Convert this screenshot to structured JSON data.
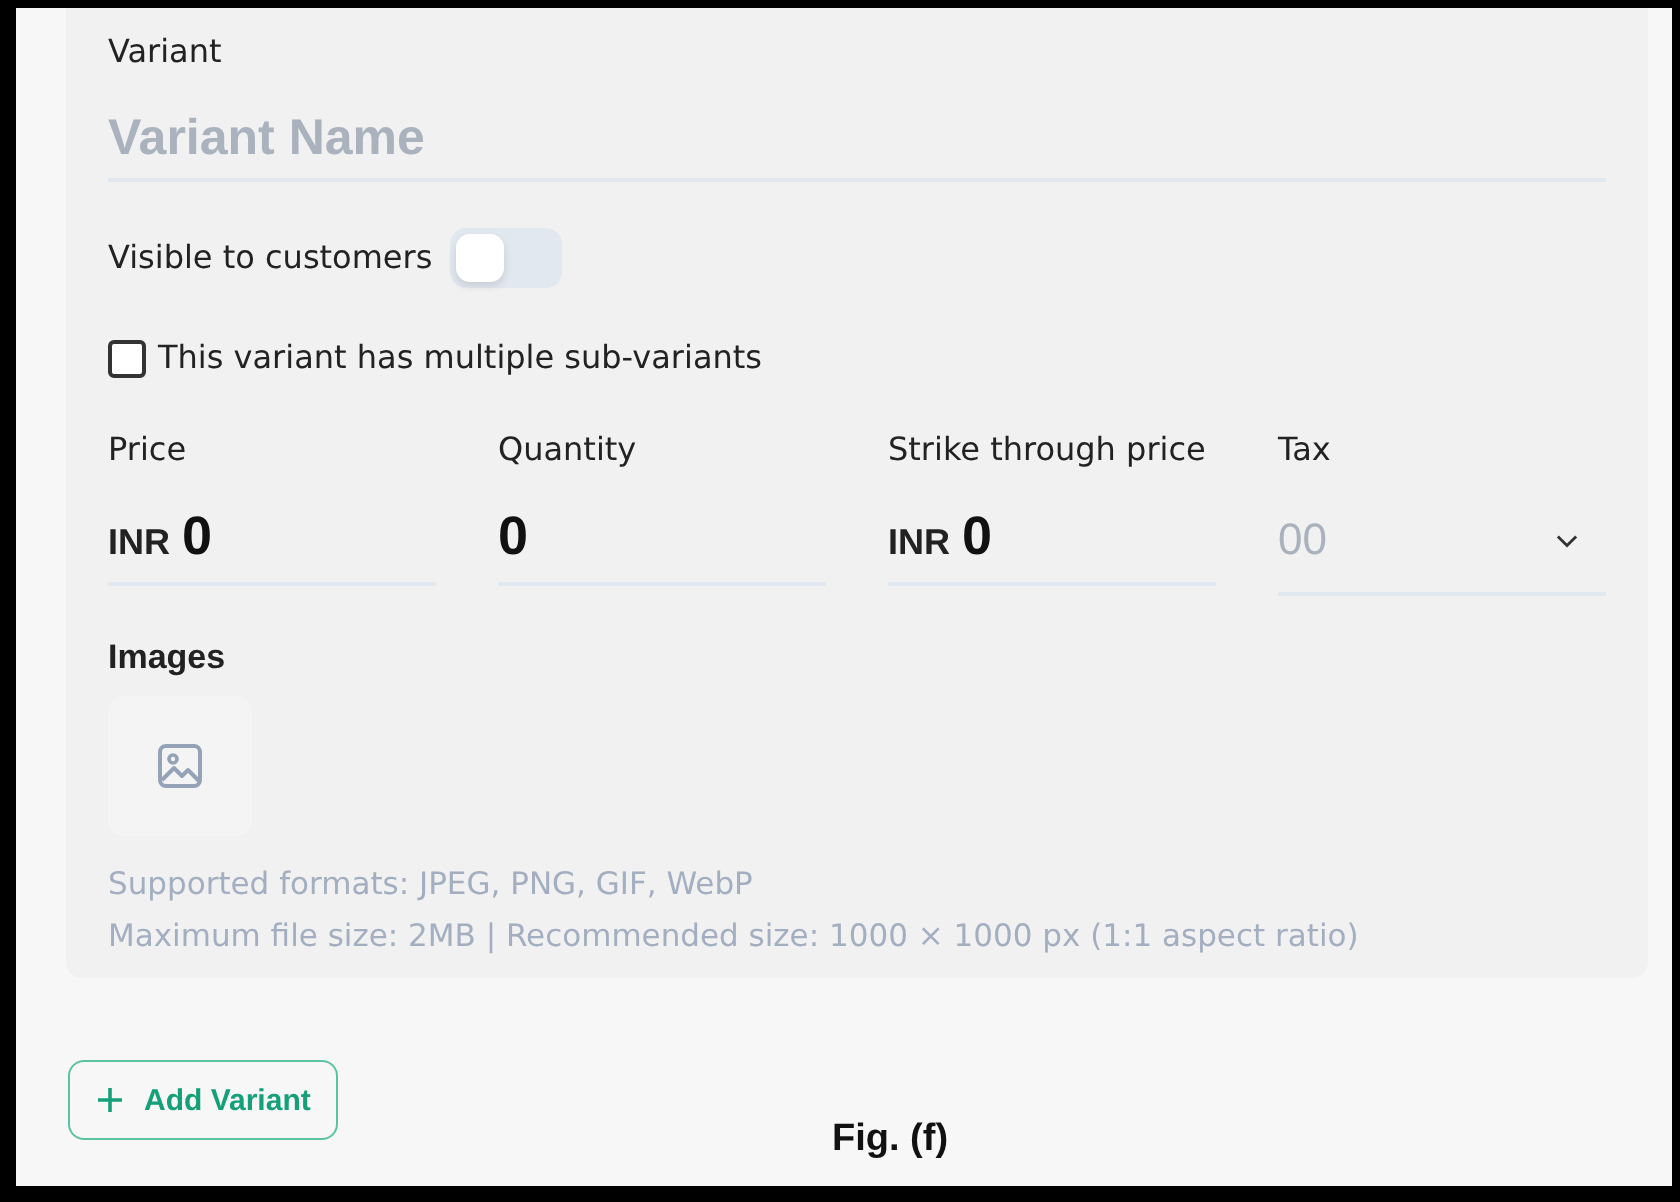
{
  "variant": {
    "title": "Variant",
    "name_field": {
      "placeholder": "Variant Name"
    },
    "visible_toggle": {
      "label": "Visible to customers",
      "on": false
    },
    "sub_variants_checkbox": {
      "label": "This variant has multiple sub-variants",
      "checked": false
    },
    "fields": [
      {
        "kind": "currency",
        "label": "Price",
        "prefix": "INR",
        "value": "0"
      },
      {
        "kind": "number",
        "label": "Quantity",
        "value": "0"
      },
      {
        "kind": "currency",
        "label": "Strike through price",
        "prefix": "INR",
        "value": "0"
      },
      {
        "kind": "select",
        "label": "Tax",
        "placeholder": "00"
      }
    ],
    "images": {
      "title": "Images",
      "help": [
        "Supported formats: JPEG, PNG, GIF, WebP",
        "Maximum file size: 2MB | Recommended size: 1000 × 1000 px (1:1 aspect ratio)"
      ]
    }
  },
  "add_button": {
    "label": "Add Variant"
  },
  "caption": "Fig. (f)"
}
